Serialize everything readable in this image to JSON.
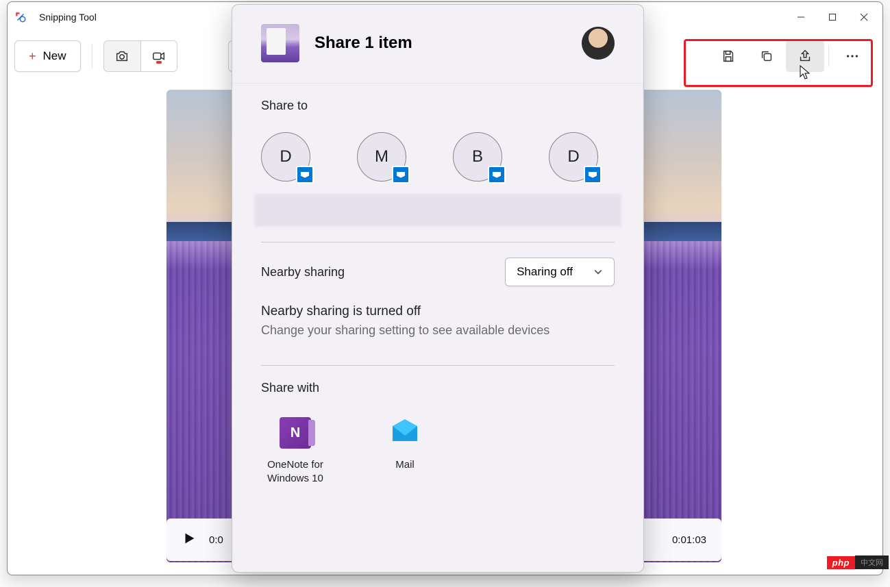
{
  "app": {
    "title": "Snipping Tool"
  },
  "toolbar": {
    "new_label": "New"
  },
  "playbar": {
    "current_time": "0:0",
    "total_time": "0:01:03"
  },
  "share": {
    "title": "Share 1 item",
    "share_to_label": "Share to",
    "contacts": [
      {
        "initial": "D"
      },
      {
        "initial": "M"
      },
      {
        "initial": "B"
      },
      {
        "initial": "D"
      }
    ],
    "nearby_label": "Nearby sharing",
    "nearby_dropdown": "Sharing off",
    "nearby_status": "Nearby sharing is turned off",
    "nearby_sub": "Change your sharing setting to see available devices",
    "share_with_label": "Share with",
    "apps": {
      "onenote": "OneNote for Windows 10",
      "mail": "Mail"
    }
  },
  "watermark": {
    "left": "php",
    "right": "中文网"
  }
}
